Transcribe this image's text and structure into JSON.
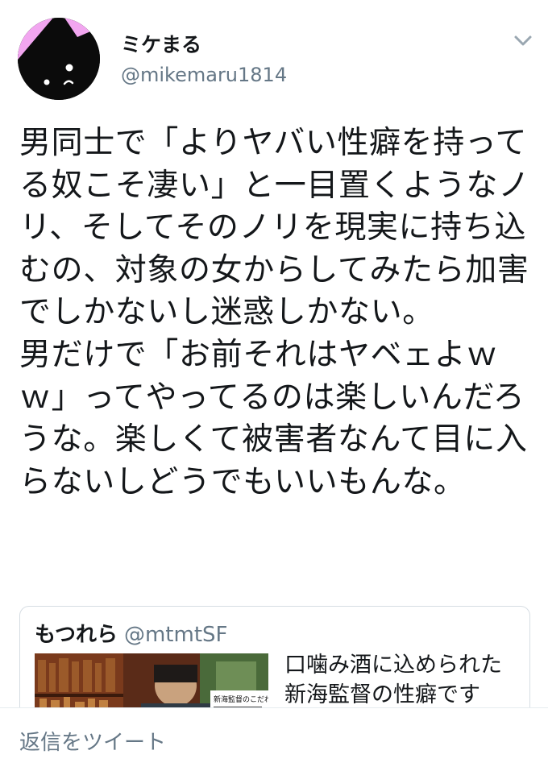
{
  "author": {
    "display_name": "ミケまる",
    "handle": "@mikemaru1814",
    "avatar": "black-cat-avatar"
  },
  "menu": {
    "icon": "chevron-down-icon"
  },
  "tweet": {
    "text": "男同士で「よりヤバい性癖を持ってる奴こそ凄い」と一目置くようなノリ、そしてそのノリを現実に持ち込むの、対象の女からしてみたら加害でしかないし迷惑しかない。\n男だけで「お前それはヤベェよｗｗ」ってやってるのは楽しいんだろうな。楽しくて被害者なんて目に入らないしどうでもいいもんな。"
  },
  "quoted_tweet": {
    "display_name": "もつれら",
    "handle": "@mtmtSF",
    "text": "口噛み酒に込められた\n新海監督の性癖です",
    "thumbnail_caption": "新海監督のこだわり"
  },
  "reply": {
    "placeholder": "返信をツイート"
  },
  "colors": {
    "text": "#14171a",
    "secondary": "#657786",
    "border": "#d6dde3",
    "avatar_pink": "#f2a6f0"
  }
}
